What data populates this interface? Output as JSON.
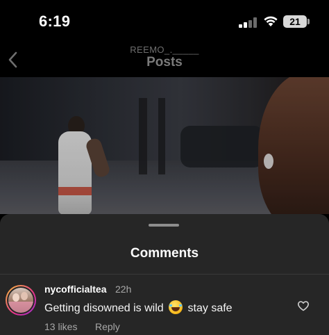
{
  "status_bar": {
    "time": "6:19",
    "battery": "21",
    "icons": [
      "signal-icon",
      "wifi-icon",
      "battery-icon"
    ]
  },
  "header": {
    "username": "REEMO_._____",
    "title": "Posts",
    "back_icon": "chevron-left-icon"
  },
  "comments_sheet": {
    "title": "Comments",
    "comments": [
      {
        "username": "nycofficialtea",
        "time": "22h",
        "text_before_emoji": "Getting disowned is wild",
        "emoji": "face-with-tears-of-joy",
        "text_after_emoji": "stay safe",
        "likes": "13 likes",
        "reply_label": "Reply",
        "like_icon": "heart-outline-icon"
      }
    ]
  },
  "colors": {
    "background": "#000000",
    "sheet_background": "#262626",
    "secondary_text": "#a8a8a8",
    "avatar_ring": "#e8338a"
  }
}
